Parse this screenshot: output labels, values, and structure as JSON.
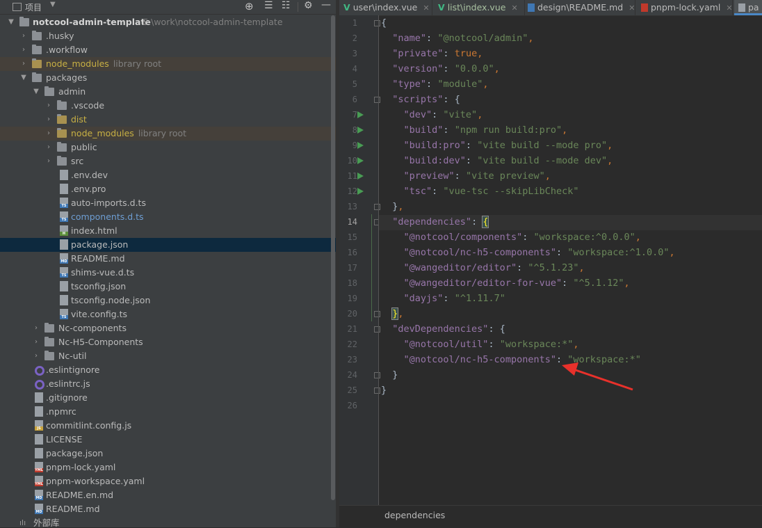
{
  "sidebar": {
    "panel_title": "项目",
    "root": {
      "name": "notcool-admin-template",
      "path": "E:\\work\\notcool-admin-template"
    },
    "library_root_hint": "library root",
    "items": [
      {
        "label": ".husky"
      },
      {
        "label": ".workflow"
      },
      {
        "label": "node_modules"
      },
      {
        "label": "packages"
      },
      {
        "label": "admin"
      },
      {
        "label": ".vscode"
      },
      {
        "label": "dist"
      },
      {
        "label": "node_modules"
      },
      {
        "label": "public"
      },
      {
        "label": "src"
      },
      {
        "label": ".env.dev"
      },
      {
        "label": ".env.pro"
      },
      {
        "label": "auto-imports.d.ts"
      },
      {
        "label": "components.d.ts"
      },
      {
        "label": "index.html"
      },
      {
        "label": "package.json"
      },
      {
        "label": "README.md"
      },
      {
        "label": "shims-vue.d.ts"
      },
      {
        "label": "tsconfig.json"
      },
      {
        "label": "tsconfig.node.json"
      },
      {
        "label": "vite.config.ts"
      },
      {
        "label": "Nc-components"
      },
      {
        "label": "Nc-H5-Components"
      },
      {
        "label": "Nc-util"
      },
      {
        "label": ".eslintignore"
      },
      {
        "label": ".eslintrc.js"
      },
      {
        "label": ".gitignore"
      },
      {
        "label": ".npmrc"
      },
      {
        "label": "commitlint.config.js"
      },
      {
        "label": "LICENSE"
      },
      {
        "label": "package.json"
      },
      {
        "label": "pnpm-lock.yaml"
      },
      {
        "label": "pnpm-workspace.yaml"
      },
      {
        "label": "README.en.md"
      },
      {
        "label": "README.md"
      },
      {
        "label": "外部库"
      }
    ],
    "toolbar_icons": [
      "target-icon",
      "collapse-all-icon",
      "expand-all-icon",
      "gear-icon",
      "minimize-icon"
    ]
  },
  "tabs": [
    {
      "label": "user\\index.vue",
      "icon": "vue-icon"
    },
    {
      "label": "list\\index.vue",
      "icon": "vue-icon"
    },
    {
      "label": "design\\README.md",
      "icon": "md-icon"
    },
    {
      "label": "pnpm-lock.yaml",
      "icon": "yml-icon"
    },
    {
      "label": "pa",
      "icon": "json-icon"
    }
  ],
  "editor": {
    "current_line": 14,
    "lines": [
      "{",
      "  \"name\": \"@notcool/admin\",",
      "  \"private\": true,",
      "  \"version\": \"0.0.0\",",
      "  \"type\": \"module\",",
      "  \"scripts\": {",
      "    \"dev\": \"vite\",",
      "    \"build\": \"npm run build:pro\",",
      "    \"build:pro\": \"vite build --mode pro\",",
      "    \"build:dev\": \"vite build --mode dev\",",
      "    \"preview\": \"vite preview\",",
      "    \"tsc\": \"vue-tsc --skipLibCheck\"",
      "  },",
      "  \"dependencies\": {",
      "    \"@notcool/components\": \"workspace:^0.0.0\",",
      "    \"@notcool/nc-h5-components\": \"workspace:^1.0.0\",",
      "    \"@wangeditor/editor\": \"^5.1.23\",",
      "    \"@wangeditor/editor-for-vue\": \"^5.1.12\",",
      "    \"dayjs\": \"^1.11.7\"",
      "  },",
      "  \"devDependencies\": {",
      "    \"@notcool/util\": \"workspace:*\",",
      "    \"@notcool/nc-h5-components\": \"workspace:*\"",
      "  }",
      "}",
      ""
    ],
    "breadcrumb": "dependencies"
  },
  "colors": {
    "key": "#9876aa",
    "string": "#6a8759",
    "keyword": "#cc7832",
    "annotation_arrow": "#e8312b"
  }
}
